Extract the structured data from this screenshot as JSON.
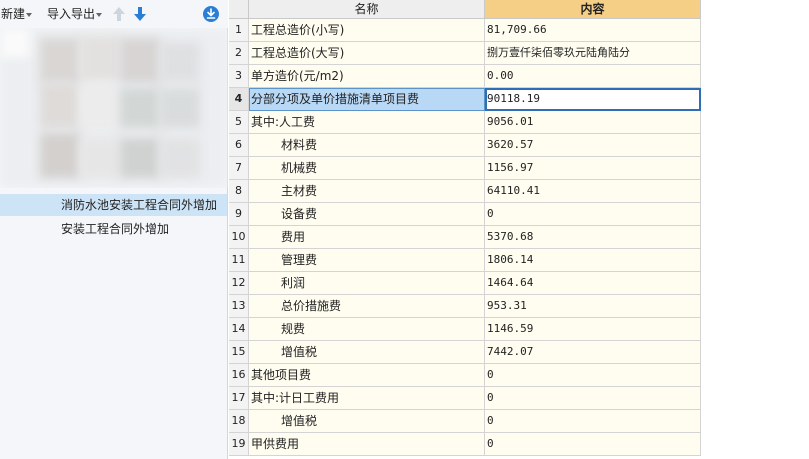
{
  "toolbar": {
    "new_label": "新建",
    "import_export_label": "导入导出"
  },
  "tree": {
    "items": [
      {
        "label": "消防水池安装工程合同外增加"
      },
      {
        "label": "安装工程合同外增加"
      }
    ]
  },
  "grid": {
    "headers": {
      "name": "名称",
      "content": "内容"
    },
    "rows": [
      {
        "num": "1",
        "name": "工程总造价(小写)",
        "value": "81,709.66"
      },
      {
        "num": "2",
        "name": "工程总造价(大写)",
        "value": "捌万壹仟柒佰零玖元陆角陆分"
      },
      {
        "num": "3",
        "name": "单方造价(元/m2)",
        "value": "0.00"
      },
      {
        "num": "4",
        "name": "分部分项及单价措施清单项目费",
        "value": "90118.19"
      },
      {
        "num": "5",
        "name": "其中:人工费",
        "value": "9056.01"
      },
      {
        "num": "6",
        "name": "材料费",
        "value": "3620.57"
      },
      {
        "num": "7",
        "name": "机械费",
        "value": "1156.97"
      },
      {
        "num": "8",
        "name": "主材费",
        "value": "64110.41"
      },
      {
        "num": "9",
        "name": "设备费",
        "value": "0"
      },
      {
        "num": "10",
        "name": "费用",
        "value": "5370.68"
      },
      {
        "num": "11",
        "name": "管理费",
        "value": "1806.14"
      },
      {
        "num": "12",
        "name": "利润",
        "value": "1464.64"
      },
      {
        "num": "13",
        "name": "总价措施费",
        "value": "953.31"
      },
      {
        "num": "14",
        "name": "规费",
        "value": "1146.59"
      },
      {
        "num": "15",
        "name": "增值税",
        "value": "7442.07"
      },
      {
        "num": "16",
        "name": "其他项目费",
        "value": "0"
      },
      {
        "num": "17",
        "name": "其中:计日工费用",
        "value": "0"
      },
      {
        "num": "18",
        "name": "增值税",
        "value": "0"
      },
      {
        "num": "19",
        "name": "甲供费用",
        "value": "0"
      }
    ]
  },
  "colors": {
    "header_content_bg": "#f6cf86",
    "selected_row_bg": "#b8d8f5",
    "tree_selected_bg": "#cde4f7",
    "accent_blue": "#2a7fd4"
  },
  "icons": [
    "arrow-up-icon",
    "arrow-down-icon",
    "download-circle-icon"
  ]
}
